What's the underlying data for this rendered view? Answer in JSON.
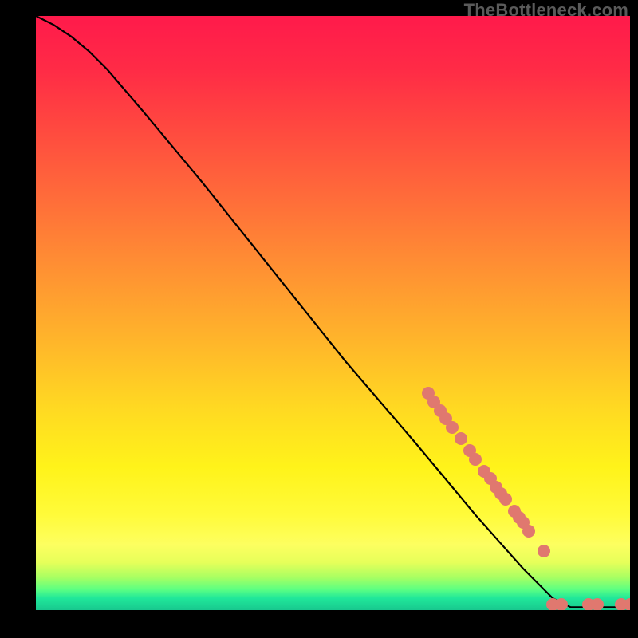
{
  "watermark": "TheBottleneck.com",
  "chart_data": {
    "type": "line",
    "title": "",
    "xlabel": "",
    "ylabel": "",
    "xlim": [
      0,
      100
    ],
    "ylim": [
      0,
      100
    ],
    "grid": false,
    "series": [
      {
        "name": "curve",
        "color": "#000000",
        "points": [
          {
            "x": 0,
            "y": 100
          },
          {
            "x": 3,
            "y": 98.5
          },
          {
            "x": 6,
            "y": 96.5
          },
          {
            "x": 9,
            "y": 94
          },
          {
            "x": 12,
            "y": 91
          },
          {
            "x": 18,
            "y": 84
          },
          {
            "x": 28,
            "y": 72
          },
          {
            "x": 40,
            "y": 57
          },
          {
            "x": 52,
            "y": 42
          },
          {
            "x": 64,
            "y": 28
          },
          {
            "x": 74,
            "y": 16
          },
          {
            "x": 82,
            "y": 7
          },
          {
            "x": 87,
            "y": 2
          },
          {
            "x": 90,
            "y": 0.5
          },
          {
            "x": 100,
            "y": 0.5
          }
        ]
      },
      {
        "name": "markers",
        "color": "#e0786f",
        "points": [
          {
            "x": 66,
            "y": 36.5
          },
          {
            "x": 67,
            "y": 35.0
          },
          {
            "x": 68,
            "y": 33.6
          },
          {
            "x": 69,
            "y": 32.2
          },
          {
            "x": 70,
            "y": 30.8
          },
          {
            "x": 71.5,
            "y": 28.8
          },
          {
            "x": 73,
            "y": 26.8
          },
          {
            "x": 74,
            "y": 25.4
          },
          {
            "x": 75.5,
            "y": 23.4
          },
          {
            "x": 76.5,
            "y": 22.1
          },
          {
            "x": 77.5,
            "y": 20.7
          },
          {
            "x": 78.3,
            "y": 19.6
          },
          {
            "x": 79.0,
            "y": 18.7
          },
          {
            "x": 80.5,
            "y": 16.7
          },
          {
            "x": 81.3,
            "y": 15.6
          },
          {
            "x": 82.0,
            "y": 14.7
          },
          {
            "x": 83.0,
            "y": 13.3
          },
          {
            "x": 85.5,
            "y": 10.0
          },
          {
            "x": 87.0,
            "y": 1.0
          },
          {
            "x": 88.5,
            "y": 1.0
          },
          {
            "x": 93.0,
            "y": 1.0
          },
          {
            "x": 94.5,
            "y": 1.0
          },
          {
            "x": 98.5,
            "y": 1.0
          },
          {
            "x": 100.0,
            "y": 1.0
          }
        ]
      }
    ]
  }
}
